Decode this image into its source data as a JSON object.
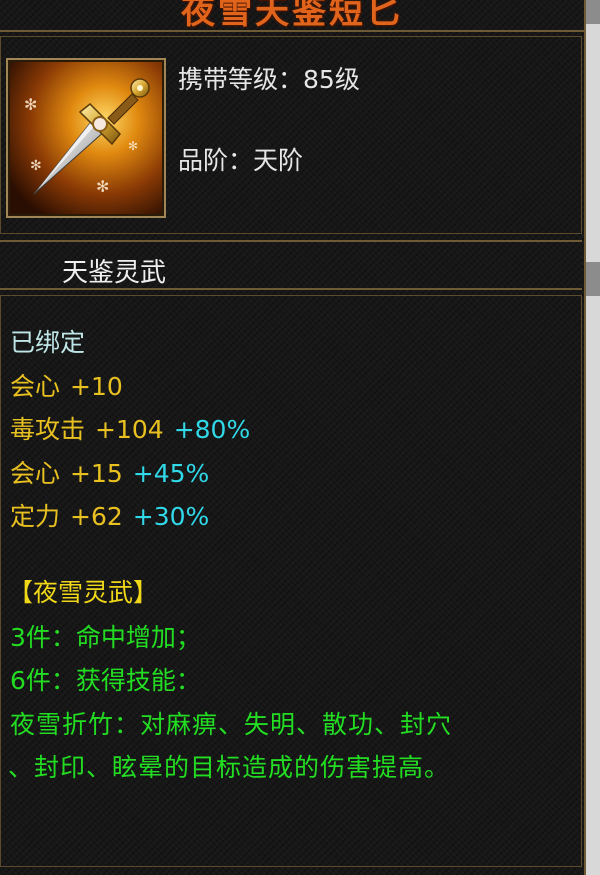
{
  "item": {
    "name": "夜雪天鉴短匕",
    "carry_level_label": "携带等级：",
    "carry_level_value": "85级",
    "grade_label": "品阶：",
    "grade_value": "天阶",
    "icon": "dagger-icon"
  },
  "section": {
    "title": "天鉴灵武"
  },
  "bound_text": "已绑定",
  "stats": [
    {
      "name": "会心",
      "base": "+10",
      "bonus": ""
    },
    {
      "name": "毒攻击",
      "base": "+104",
      "bonus": "+80%"
    },
    {
      "name": "会心",
      "base": "+15",
      "bonus": "+45%"
    },
    {
      "name": "定力",
      "base": "+62",
      "bonus": "+30%"
    }
  ],
  "set": {
    "name": "【夜雪灵武】",
    "bonus_3": "3件：命中增加；",
    "bonus_6": "6件：获得技能：",
    "skill_line1": "夜雪折竹：对麻痹、失明、散功、封穴",
    "skill_line2": "、封印、眩晕的目标造成的伤害提高。"
  },
  "colors": {
    "title": "#e0641c",
    "stat_name": "#e8c020",
    "bonus": "#30d8e8",
    "set_name": "#f0d818",
    "set_text": "#22dd22",
    "frame": "#6e5a35"
  }
}
